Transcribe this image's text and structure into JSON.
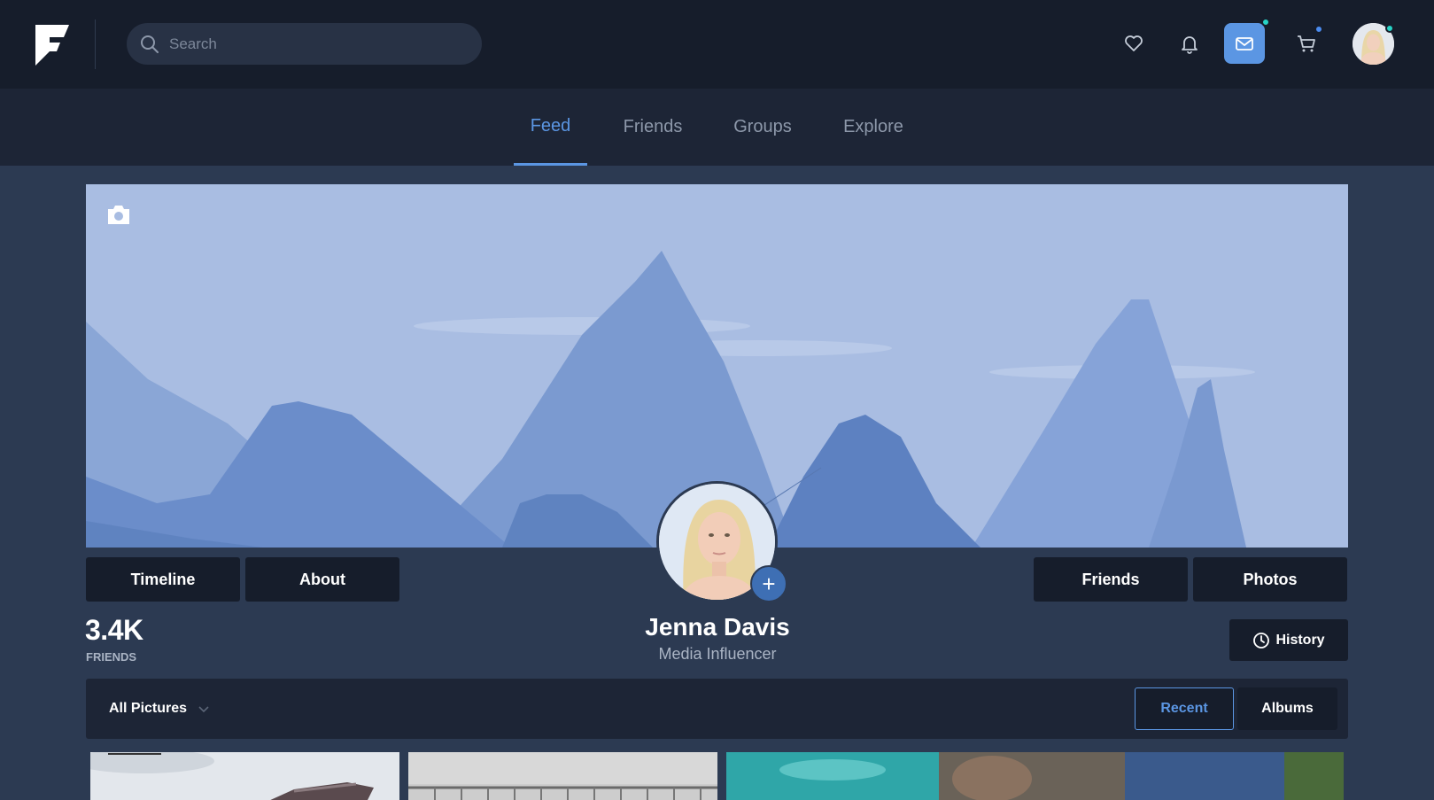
{
  "header": {
    "search_placeholder": "Search",
    "icons": [
      "heart-icon",
      "bell-icon",
      "mail-icon",
      "cart-icon"
    ]
  },
  "nav": {
    "tabs": [
      {
        "label": "Feed",
        "active": true
      },
      {
        "label": "Friends",
        "active": false
      },
      {
        "label": "Groups",
        "active": false
      },
      {
        "label": "Explore",
        "active": false
      }
    ]
  },
  "profile": {
    "left_buttons": [
      "Timeline",
      "About"
    ],
    "right_buttons": [
      "Friends",
      "Photos"
    ],
    "friends_count": "3.4K",
    "friends_label": "FRIENDS",
    "name": "Jenna Davis",
    "role": "Media Influencer",
    "history_label": "History",
    "add_symbol": "+"
  },
  "gallery": {
    "filter_label": "All Pictures",
    "view_buttons": [
      {
        "label": "Recent",
        "active": true
      },
      {
        "label": "Albums",
        "active": false
      }
    ]
  },
  "colors": {
    "accent": "#5b96e3",
    "online_dot": "#27d3c6",
    "background": "#2c3a52",
    "topbar": "#161d2b"
  }
}
